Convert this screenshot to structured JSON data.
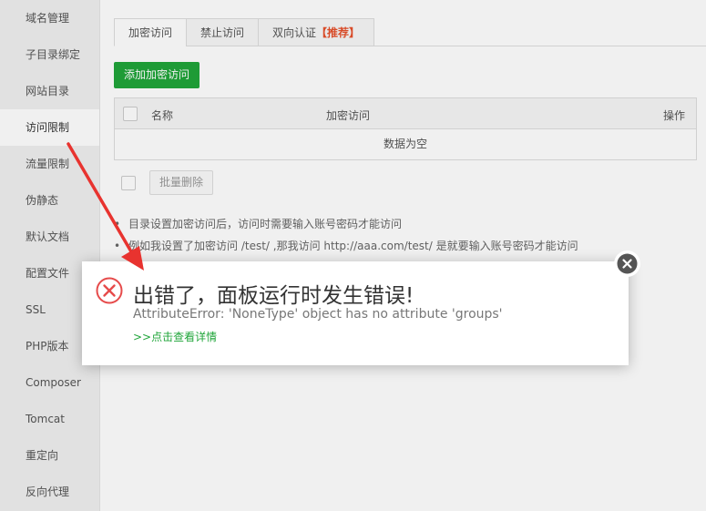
{
  "sidebar": {
    "items": [
      {
        "label": "域名管理"
      },
      {
        "label": "子目录绑定"
      },
      {
        "label": "网站目录"
      },
      {
        "label": "访问限制",
        "active": true
      },
      {
        "label": "流量限制"
      },
      {
        "label": "伪静态"
      },
      {
        "label": "默认文档"
      },
      {
        "label": "配置文件"
      },
      {
        "label": "SSL"
      },
      {
        "label": "PHP版本"
      },
      {
        "label": "Composer"
      },
      {
        "label": "Tomcat"
      },
      {
        "label": "重定向"
      },
      {
        "label": "反向代理"
      }
    ]
  },
  "tabs": [
    {
      "label": "加密访问",
      "active": true
    },
    {
      "label": "禁止访问"
    },
    {
      "label": "双向认证",
      "badge": "【推荐】"
    }
  ],
  "toolbar": {
    "add_label": "添加加密访问"
  },
  "table": {
    "columns": {
      "name": "名称",
      "auth": "加密访问",
      "op": "操作"
    },
    "empty_text": "数据为空"
  },
  "batch": {
    "delete_label": "批量删除"
  },
  "tips": [
    "目录设置加密访问后，访问时需要输入账号密码才能访问",
    "例如我设置了加密访问 /test/ ,那我访问 http://aaa.com/test/ 是就要输入账号密码才能访问"
  ],
  "dialog": {
    "title": "出错了，面板运行时发生错误!",
    "message": "AttributeError: 'NoneType' object has no attribute 'groups'",
    "link": ">>点击查看详情"
  },
  "colors": {
    "accent": "#20a53a",
    "error": "#e64b4b",
    "badge": "#e6502b",
    "annotation": "#e8332f"
  },
  "icons": {
    "dialog_icon": "error-circle-x-icon",
    "close_icon": "close-circle-icon"
  }
}
